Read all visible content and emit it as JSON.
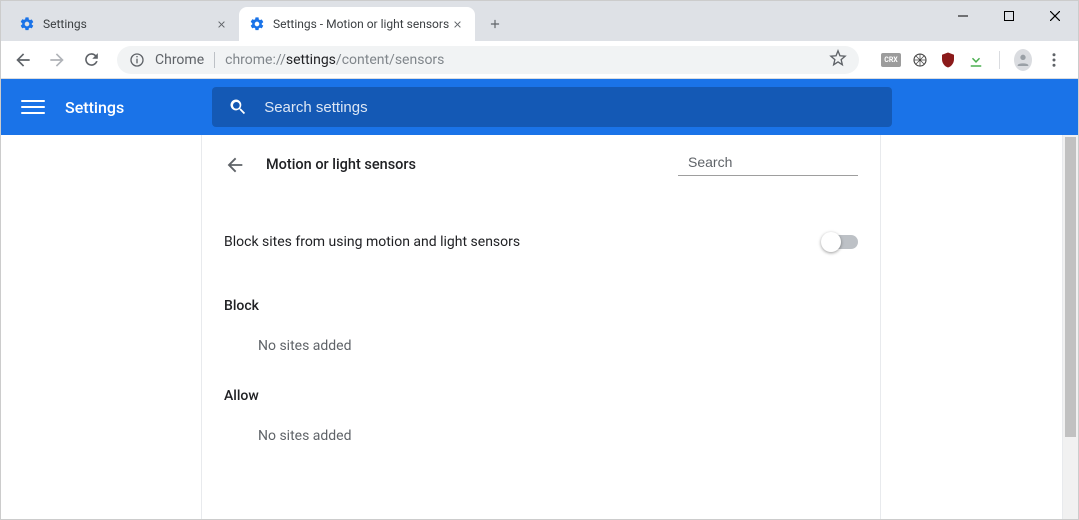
{
  "tabs": [
    {
      "title": "Settings"
    },
    {
      "title": "Settings - Motion or light sensors"
    }
  ],
  "omnibox": {
    "scheme_label": "Chrome",
    "url_prefix": "chrome://",
    "url_bold": "settings",
    "url_suffix": "/content/sensors"
  },
  "app": {
    "title": "Settings",
    "search_placeholder": "Search settings"
  },
  "page": {
    "heading": "Motion or light sensors",
    "inline_search_placeholder": "Search",
    "toggle_label": "Block sites from using motion and light sensors",
    "toggle_on": false,
    "sections": {
      "block": {
        "heading": "Block",
        "empty_text": "No sites added"
      },
      "allow": {
        "heading": "Allow",
        "empty_text": "No sites added"
      }
    }
  }
}
